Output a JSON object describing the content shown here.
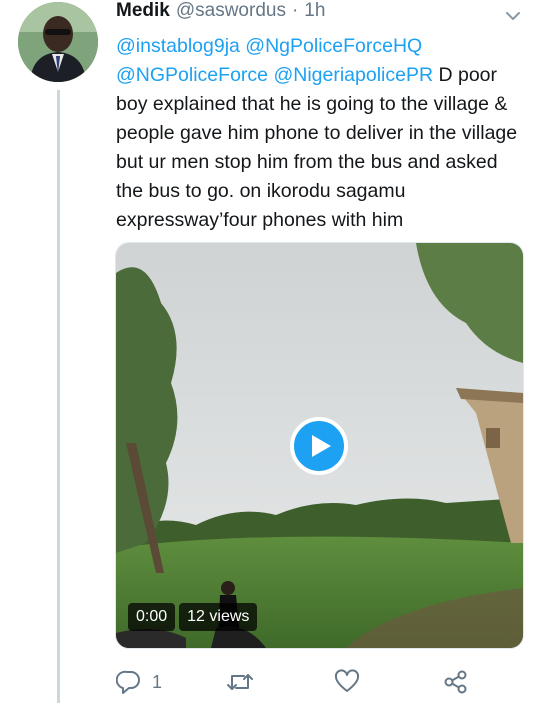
{
  "tweet": {
    "author_name": "Medik",
    "author_handle": "@saswordus",
    "separator": "·",
    "time": "1h",
    "mentions": [
      "@instablog9ja",
      "@NgPoliceForceHQ",
      "@NGPoliceForce",
      "@NigeriapolicePR"
    ],
    "body_text": "D poor boy explained that he is going to the village & people gave him phone to deliver in the village but ur men stop him from the bus and asked the bus to go. on ikorodu sagamu expressway’four phones with him"
  },
  "video": {
    "timestamp": "0:00",
    "views": "12 views"
  },
  "actions": {
    "reply_count": "1",
    "retweet_count": "",
    "like_count": ""
  },
  "colors": {
    "accent": "#1da1f2",
    "muted": "#657786",
    "text": "#14171a",
    "thread_line": "#ccd6dd"
  },
  "icons": [
    "chevron-down-icon",
    "play-icon",
    "reply-icon",
    "retweet-icon",
    "like-icon",
    "share-icon"
  ]
}
